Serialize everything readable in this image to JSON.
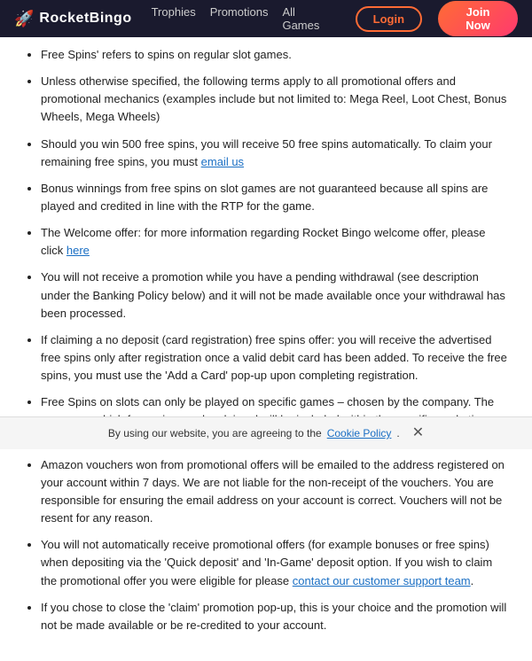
{
  "header": {
    "logo_text": "RocketBingo",
    "rocket_icon": "🚀",
    "nav": [
      {
        "label": "Trophies",
        "id": "trophies"
      },
      {
        "label": "Promotions",
        "id": "promotions"
      },
      {
        "label": "All Games",
        "id": "all-games"
      }
    ],
    "login_label": "Login",
    "join_label": "Join Now"
  },
  "content": {
    "items": [
      {
        "id": 1,
        "text": "Free Spins' refers to spins on regular slot games.",
        "links": []
      },
      {
        "id": 2,
        "text": "Unless otherwise specified, the following terms apply to all promotional offers and promotional mechanics (examples include but not limited to: Mega Reel, Loot Chest, Bonus Wheels, Mega Wheels)",
        "links": []
      },
      {
        "id": 3,
        "text_before": "Should you win 500 free spins, you will receive 50 free spins automatically. To claim your remaining free spins, you must ",
        "link_text": "email us",
        "text_after": "",
        "has_link": true
      },
      {
        "id": 4,
        "text": "Bonus winnings from free spins on slot games are not guaranteed because all spins are played and credited in line with the RTP for the game.",
        "links": []
      },
      {
        "id": 5,
        "text_before": "The Welcome offer: for more information regarding Rocket Bingo welcome offer, please click ",
        "link_text": "here",
        "text_after": "",
        "has_link": true
      },
      {
        "id": 6,
        "text": "You will not receive a promotion while you have a pending withdrawal (see description under the Banking Policy below) and it will not be made available once your withdrawal has been processed.",
        "links": []
      },
      {
        "id": 7,
        "text": "If claiming a no deposit (card registration) free spins offer: you will receive the advertised free spins only after registration once a valid debit card has been added. To receive the free spins, you must use the 'Add a Card' pop-up upon completing registration.",
        "links": []
      },
      {
        "id": 8,
        "text": "Free Spins on slots can only be played on specific games – chosen by the company. The games on which free spins can be claimed will be included within the specific marketing material for the offer.",
        "links": []
      },
      {
        "id": 9,
        "text": "Amazon vouchers won from promotional offers will be emailed to the address registered on your account within 7 days. We are not liable for the non-receipt of the vouchers. You are responsible for ensuring the email address on your account is correct. Vouchers will not be resent for any reason.",
        "links": []
      },
      {
        "id": 10,
        "text_before": "You will not automatically receive promotional offers (for example bonuses or free spins) when depositing via the 'Quick deposit' and 'In-Game' deposit option. If you wish to claim the promotional offer you were eligible for please ",
        "link_text": "contact our customer support team",
        "text_after": ".",
        "has_link": true
      },
      {
        "id": 11,
        "text": "If you chose to close the 'claim' promotion pop-up, this is your choice and the promotion will not be made available or be re-credited to your account.",
        "links": []
      }
    ]
  },
  "cookie": {
    "text": "By using our website, you are agreeing to the ",
    "link_text": "Cookie Policy",
    "close_icon": "✕"
  }
}
